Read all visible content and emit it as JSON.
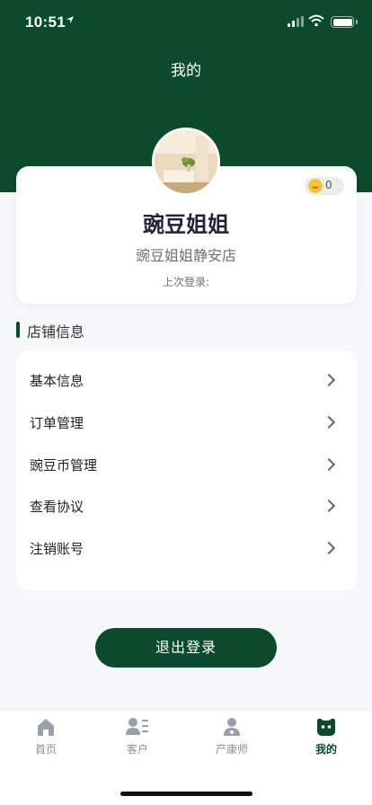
{
  "status_bar": {
    "time": "10:51"
  },
  "header": {
    "title": "我的"
  },
  "profile": {
    "coin_count": "0",
    "name": "豌豆姐姐",
    "store": "豌豆姐姐静安店",
    "last_login_label": "上次登录:"
  },
  "section": {
    "title": "店铺信息"
  },
  "menu": {
    "items": [
      {
        "label": "基本信息"
      },
      {
        "label": "订单管理"
      },
      {
        "label": "豌豆币管理"
      },
      {
        "label": "查看协议"
      },
      {
        "label": "注销账号"
      }
    ]
  },
  "logout_label": "退出登录",
  "tabbar": {
    "tabs": [
      {
        "label": "首页",
        "icon": "home-icon"
      },
      {
        "label": "客户",
        "icon": "customers-icon"
      },
      {
        "label": "产康师",
        "icon": "therapist-icon"
      },
      {
        "label": "我的",
        "icon": "profile-icon",
        "active": true
      }
    ]
  },
  "colors": {
    "brand": "#0b4a2c",
    "background": "#f6f7f9",
    "coin": "#f2c33a"
  }
}
